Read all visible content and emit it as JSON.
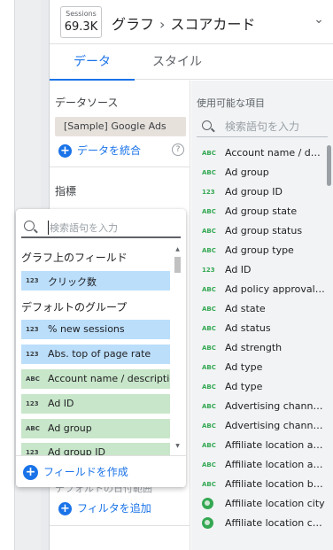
{
  "chip": {
    "label": "Sessions",
    "value": "69.3K"
  },
  "breadcrumb": {
    "parent": "グラフ",
    "separator": "›",
    "current": "スコアカード",
    "collapse_glyph": "⌄"
  },
  "tabs": [
    {
      "label": "データ",
      "active": true
    },
    {
      "label": "スタイル",
      "active": false
    }
  ],
  "data_source": {
    "title": "データソース",
    "name": "[Sample] Google Ads",
    "blend_label": "データを統合",
    "help_glyph": "?"
  },
  "metrics": {
    "title": "指標"
  },
  "filter": {
    "add_label": "フィルタを追加",
    "hidden_text": "デフォルトの日付範囲"
  },
  "available": {
    "title": "使用可能な項目",
    "search_placeholder": "検索語句を入力",
    "fields": [
      {
        "type": "ABC",
        "name": "Account name / descr..."
      },
      {
        "type": "ABC",
        "name": "Ad group"
      },
      {
        "type": "123",
        "name": "Ad group ID"
      },
      {
        "type": "ABC",
        "name": "Ad group state"
      },
      {
        "type": "ABC",
        "name": "Ad group status"
      },
      {
        "type": "ABC",
        "name": "Ad group type"
      },
      {
        "type": "123",
        "name": "Ad ID"
      },
      {
        "type": "ABC",
        "name": "Ad policy approval sta..."
      },
      {
        "type": "ABC",
        "name": "Ad state"
      },
      {
        "type": "ABC",
        "name": "Ad status"
      },
      {
        "type": "ABC",
        "name": "Ad strength"
      },
      {
        "type": "ABC",
        "name": "Ad type"
      },
      {
        "type": "ABC",
        "name": "Ad type"
      },
      {
        "type": "ABC",
        "name": "Advertising channel s..."
      },
      {
        "type": "ABC",
        "name": "Advertising channel ty..."
      },
      {
        "type": "ABC",
        "name": "Affiliate location addr..."
      },
      {
        "type": "ABC",
        "name": "Affiliate location addr..."
      },
      {
        "type": "ABC",
        "name": "Affiliate location busi..."
      },
      {
        "type": "GEO",
        "name": "Affiliate location city"
      },
      {
        "type": "GEO",
        "name": "Affiliate location coun..."
      }
    ]
  },
  "popup": {
    "search_placeholder": "検索語句を入力",
    "chart_fields_title": "グラフ上のフィールド",
    "chart_fields": [
      {
        "type": "123",
        "name": "クリック数",
        "kind": "metric"
      }
    ],
    "default_group_title": "デフォルトのグループ",
    "default_fields": [
      {
        "type": "123",
        "name": "% new sessions",
        "kind": "metric"
      },
      {
        "type": "123",
        "name": "Abs. top of page rate",
        "kind": "metric"
      },
      {
        "type": "ABC",
        "name": "Account name / description",
        "kind": "dim"
      },
      {
        "type": "123",
        "name": "Ad ID",
        "kind": "dim"
      },
      {
        "type": "ABC",
        "name": "Ad group",
        "kind": "dim"
      },
      {
        "type": "123",
        "name": "Ad group ID",
        "kind": "dim"
      }
    ],
    "create_field_label": "フィールドを作成",
    "scroll_up_glyph": "▲",
    "scroll_down_glyph": "▼"
  },
  "colors": {
    "accent": "#1a73e8",
    "metric_bg": "#bbdefb",
    "dimension_bg": "#c8e6c9",
    "dimension_type": "#34a853"
  }
}
